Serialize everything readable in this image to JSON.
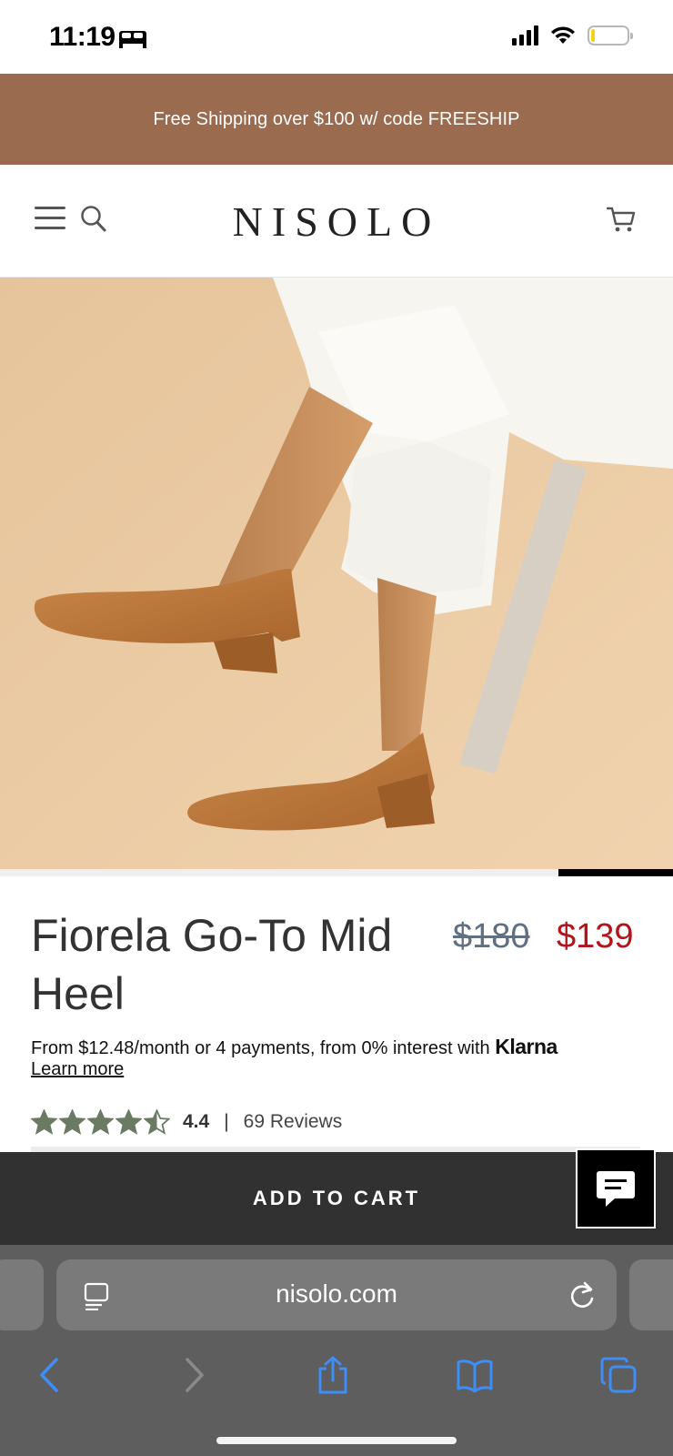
{
  "status_bar": {
    "time": "11:19",
    "battery_level": 0.1
  },
  "promo": {
    "text": "Free Shipping over $100 w/ code FREESHIP",
    "bg_color": "#9a6b4e"
  },
  "header": {
    "logo": "NISOLO",
    "icons": [
      "menu-icon",
      "search-icon",
      "cart-icon"
    ]
  },
  "hero": {
    "carousel_position": 0.17
  },
  "product": {
    "title": "Fiorela Go-To Mid Heel",
    "price_original": "$180",
    "price_sale": "$139",
    "sale_color": "#b3141b",
    "financing_text": "From $12.48/month or 4 payments, from 0% interest with",
    "financing_brand": "Klarna",
    "learn_more": "Learn more",
    "rating": {
      "stars": 4.5,
      "value": "4.4",
      "separator": "|",
      "reviews": "69 Reviews"
    }
  },
  "cta": {
    "add_to_cart": "ADD TO CART"
  },
  "browser": {
    "url": "nisolo.com"
  }
}
